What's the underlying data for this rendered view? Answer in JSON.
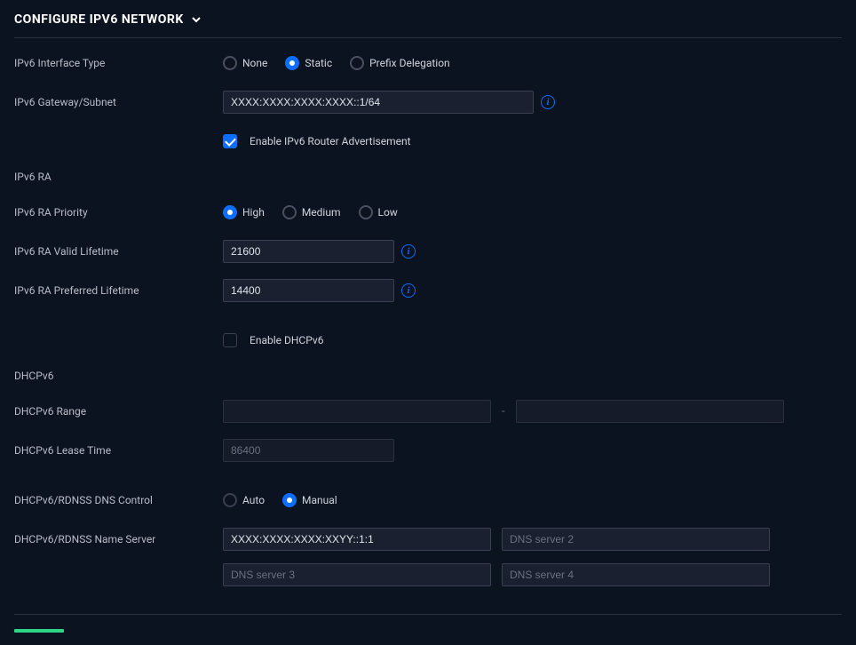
{
  "header": {
    "title": "CONFIGURE IPV6 NETWORK"
  },
  "labels": {
    "interface_type": "IPv6 Interface Type",
    "gateway_subnet": "IPv6 Gateway/Subnet",
    "ra": "IPv6 RA",
    "ra_priority": "IPv6 RA Priority",
    "ra_valid_lifetime": "IPv6 RA Valid Lifetime",
    "ra_preferred_lifetime": "IPv6 RA Preferred Lifetime",
    "dhcpv6": "DHCPv6",
    "dhcpv6_range": "DHCPv6 Range",
    "dhcpv6_lease_time": "DHCPv6 Lease Time",
    "dns_control": "DHCPv6/RDNSS DNS Control",
    "name_server": "DHCPv6/RDNSS Name Server"
  },
  "interface_type": {
    "options": {
      "none": "None",
      "static": "Static",
      "prefix": "Prefix Delegation"
    },
    "selected": "static"
  },
  "gateway_subnet": {
    "value": "XXXX:XXXX:XXXX:XXXX::1/64"
  },
  "ra": {
    "enable_label": "Enable IPv6 Router Advertisement",
    "enabled": true
  },
  "ra_priority": {
    "options": {
      "high": "High",
      "medium": "Medium",
      "low": "Low"
    },
    "selected": "high"
  },
  "ra_valid_lifetime": {
    "value": "21600"
  },
  "ra_preferred_lifetime": {
    "value": "14400"
  },
  "dhcpv6": {
    "enable_label": "Enable DHCPv6",
    "enabled": false
  },
  "dhcpv6_range": {
    "start": "",
    "stop": "",
    "sep": "-"
  },
  "dhcpv6_lease_time": {
    "placeholder": "86400",
    "value": ""
  },
  "dns_control": {
    "options": {
      "auto": "Auto",
      "manual": "Manual"
    },
    "selected": "manual"
  },
  "name_server": {
    "s1": "XXXX:XXXX:XXXX:XXYY::1:1",
    "s2_placeholder": "DNS server 2",
    "s3_placeholder": "DNS server 3",
    "s4_placeholder": "DNS server 4"
  },
  "colors": {
    "accent_blue": "#0d6efd",
    "accent_green": "#2ed587",
    "bg": "#0b1220"
  }
}
